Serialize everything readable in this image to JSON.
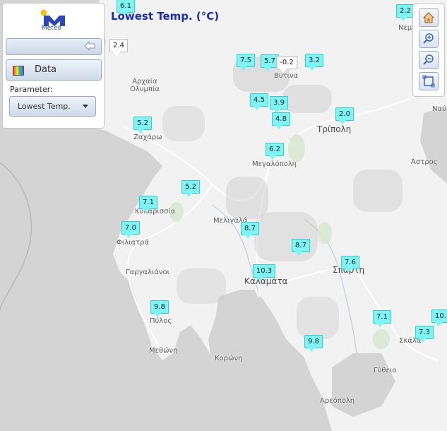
{
  "title": "Lowest Temp. (°C)",
  "panel": {
    "logo_text": "Meteo",
    "data_button": "Data",
    "parameter_label": "Parameter:",
    "parameter_value": "Lowest Temp."
  },
  "toolbar": {
    "buttons": [
      "home-icon",
      "zoom-in-icon",
      "zoom-out-icon",
      "full-extent-icon"
    ]
  },
  "places": [
    {
      "id": "archaia-olympia",
      "name": "Αρχαία\nΟλυμπία"
    },
    {
      "id": "vytina",
      "name": "Βυτινα"
    },
    {
      "id": "tripoli",
      "name": "Τρίπολη"
    },
    {
      "id": "zacharo",
      "name": "Ζαχάρω"
    },
    {
      "id": "megalopoli",
      "name": "Μεγαλόπολη"
    },
    {
      "id": "astros",
      "name": "Άστρος"
    },
    {
      "id": "kyparissia",
      "name": "Κυπαρισσία"
    },
    {
      "id": "meligalas",
      "name": "Μελιγαλά"
    },
    {
      "id": "filiatra",
      "name": "Φιλιατρά"
    },
    {
      "id": "gargaliani",
      "name": "Γαργαλιάνοι"
    },
    {
      "id": "kalamata",
      "name": "Καλαμάτα"
    },
    {
      "id": "sparti",
      "name": "Σπάρτη"
    },
    {
      "id": "pylos",
      "name": "Πύλος"
    },
    {
      "id": "methoni",
      "name": "Μεθώνη"
    },
    {
      "id": "koroni",
      "name": "Κορώνη"
    },
    {
      "id": "skala",
      "name": "Σκάλα"
    },
    {
      "id": "gytheio",
      "name": "Γύθειο"
    },
    {
      "id": "areopoli",
      "name": "Αρεόπολη"
    },
    {
      "id": "nemea",
      "name": "Νεμ"
    },
    {
      "id": "nafplio",
      "name": "Ναύ"
    }
  ],
  "stations": [
    {
      "value": "6.1",
      "style": "cyan"
    },
    {
      "value": "2.2",
      "style": "cyan"
    },
    {
      "value": "2.4",
      "style": "white"
    },
    {
      "value": "7.5",
      "style": "cyan"
    },
    {
      "value": "5.7",
      "style": "cyan"
    },
    {
      "value": "-0.2",
      "style": "white"
    },
    {
      "value": "3.2",
      "style": "cyan"
    },
    {
      "value": "4.5",
      "style": "cyan"
    },
    {
      "value": "3.9",
      "style": "cyan"
    },
    {
      "value": "4.8",
      "style": "cyan"
    },
    {
      "value": "2.0",
      "style": "cyan"
    },
    {
      "value": "5.2",
      "style": "cyan"
    },
    {
      "value": "6.2",
      "style": "cyan"
    },
    {
      "value": "5.2",
      "style": "cyan"
    },
    {
      "value": "7.1",
      "style": "cyan"
    },
    {
      "value": "7.0",
      "style": "cyan"
    },
    {
      "value": "8.7",
      "style": "cyan"
    },
    {
      "value": "8.7",
      "style": "cyan"
    },
    {
      "value": "7.6",
      "style": "cyan"
    },
    {
      "value": "10.3",
      "style": "cyan"
    },
    {
      "value": "9.8",
      "style": "cyan"
    },
    {
      "value": "7.1",
      "style": "cyan"
    },
    {
      "value": "10.",
      "style": "cyan"
    },
    {
      "value": "7.3",
      "style": "cyan"
    },
    {
      "value": "9.8",
      "style": "cyan"
    }
  ],
  "colors": {
    "title": "#1a2fb0",
    "marker": "#7ef4f4",
    "sea": "#d4d4d4",
    "land": "#f2f2f2"
  }
}
